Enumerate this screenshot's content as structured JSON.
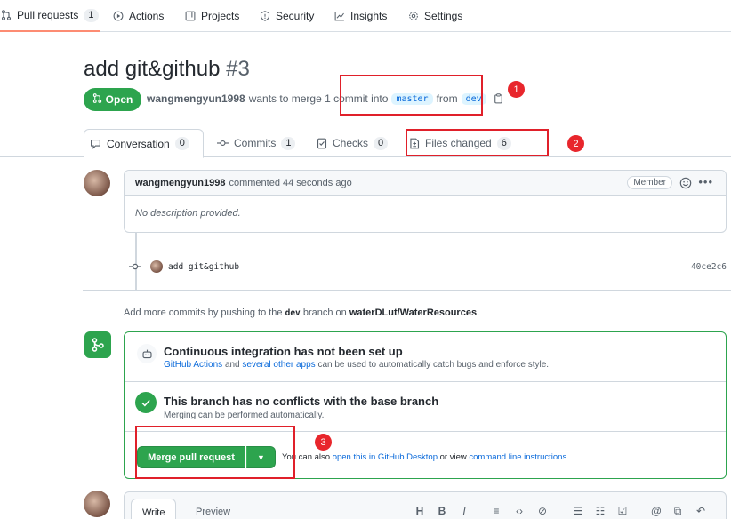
{
  "repo_nav": [
    {
      "label": "Pull requests",
      "count": "1",
      "icon": "git-pull-request-icon",
      "active": true
    },
    {
      "label": "Actions",
      "icon": "play-icon"
    },
    {
      "label": "Projects",
      "icon": "table-icon"
    },
    {
      "label": "Security",
      "icon": "shield-icon"
    },
    {
      "label": "Insights",
      "icon": "graph-icon"
    },
    {
      "label": "Settings",
      "icon": "gear-icon"
    }
  ],
  "pr": {
    "title": "add git&github",
    "number": "#3",
    "state": "Open",
    "author": "wangmengyun1998",
    "meta_text": "wants to merge 1 commit into",
    "base_branch": "master",
    "from_text": "from",
    "head_branch": "dev"
  },
  "tabs": [
    {
      "label": "Conversation",
      "count": "0",
      "icon": "comment-icon"
    },
    {
      "label": "Commits",
      "count": "1",
      "icon": "git-commit-icon"
    },
    {
      "label": "Checks",
      "count": "0",
      "icon": "checklist-icon"
    },
    {
      "label": "Files changed",
      "count": "6",
      "icon": "file-diff-icon"
    }
  ],
  "annotations": [
    "1",
    "2",
    "3"
  ],
  "comment": {
    "author": "wangmengyun1998",
    "time_text": "commented 44 seconds ago",
    "role_badge": "Member",
    "body": "No description provided."
  },
  "commit": {
    "message": "add git&github",
    "sha": "40ce2c6"
  },
  "push_hint": {
    "prefix": "Add more commits by pushing to the",
    "branch": "dev",
    "middle": "branch on",
    "repo": "waterDLut/WaterResources",
    "suffix": "."
  },
  "merge_box": {
    "ci_title": "Continuous integration has not been set up",
    "ci_link1": "GitHub Actions",
    "ci_and": "and",
    "ci_link2": "several other apps",
    "ci_rest": "can be used to automatically catch bugs and enforce style.",
    "conflict_title": "This branch has no conflicts with the base branch",
    "conflict_sub": "Merging can be performed automatically.",
    "merge_button": "Merge pull request",
    "also_prefix": "You can also",
    "also_link1": "open this in GitHub Desktop",
    "also_mid": "or view",
    "also_link2": "command line instructions",
    "also_suffix": "."
  },
  "editor": {
    "write_tab": "Write",
    "preview_tab": "Preview",
    "toolbar": [
      "H",
      "B",
      "I"
    ]
  }
}
